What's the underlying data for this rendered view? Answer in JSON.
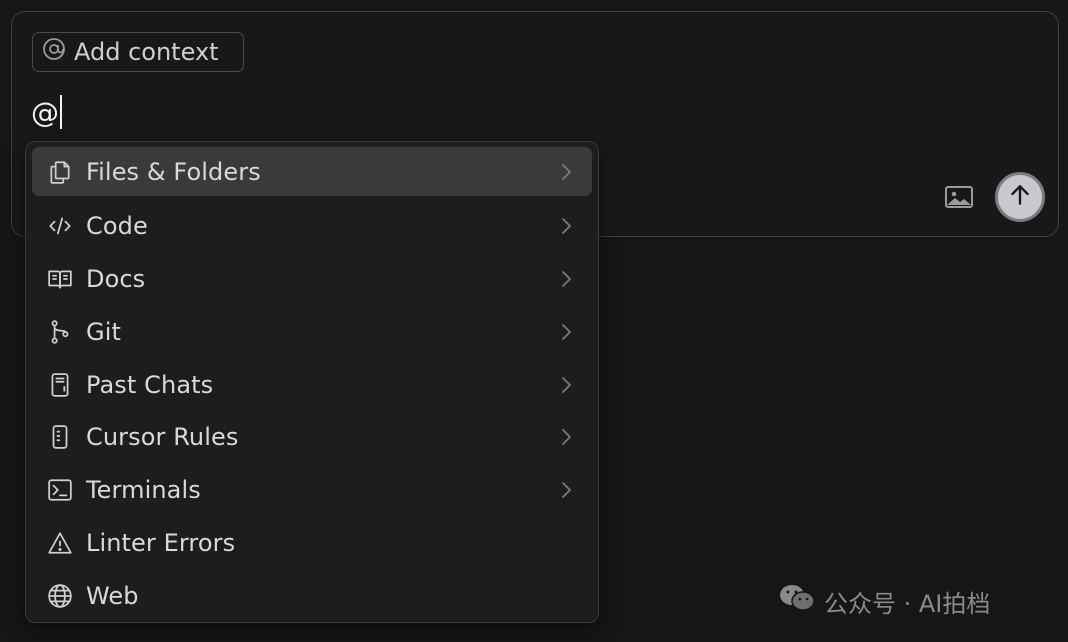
{
  "chat": {
    "add_context_label": "Add context",
    "input_value": "@"
  },
  "menu": {
    "items": [
      {
        "label": "Files & Folders",
        "icon": "files-icon",
        "has_submenu": true,
        "selected": true
      },
      {
        "label": "Code",
        "icon": "code-icon",
        "has_submenu": true
      },
      {
        "label": "Docs",
        "icon": "book-icon",
        "has_submenu": true
      },
      {
        "label": "Git",
        "icon": "git-branch-icon",
        "has_submenu": true
      },
      {
        "label": "Past Chats",
        "icon": "notebook-icon",
        "has_submenu": true
      },
      {
        "label": "Cursor Rules",
        "icon": "rules-icon",
        "has_submenu": true
      },
      {
        "label": "Terminals",
        "icon": "terminal-icon",
        "has_submenu": true
      },
      {
        "label": "Linter Errors",
        "icon": "warning-icon",
        "has_submenu": false
      },
      {
        "label": "Web",
        "icon": "globe-icon",
        "has_submenu": false
      }
    ]
  },
  "watermark": {
    "text": "公众号 · AI拍档"
  },
  "colors": {
    "background": "#161616",
    "menu_selected": "#3a3a3a",
    "send_button": "#c7c9cf"
  }
}
